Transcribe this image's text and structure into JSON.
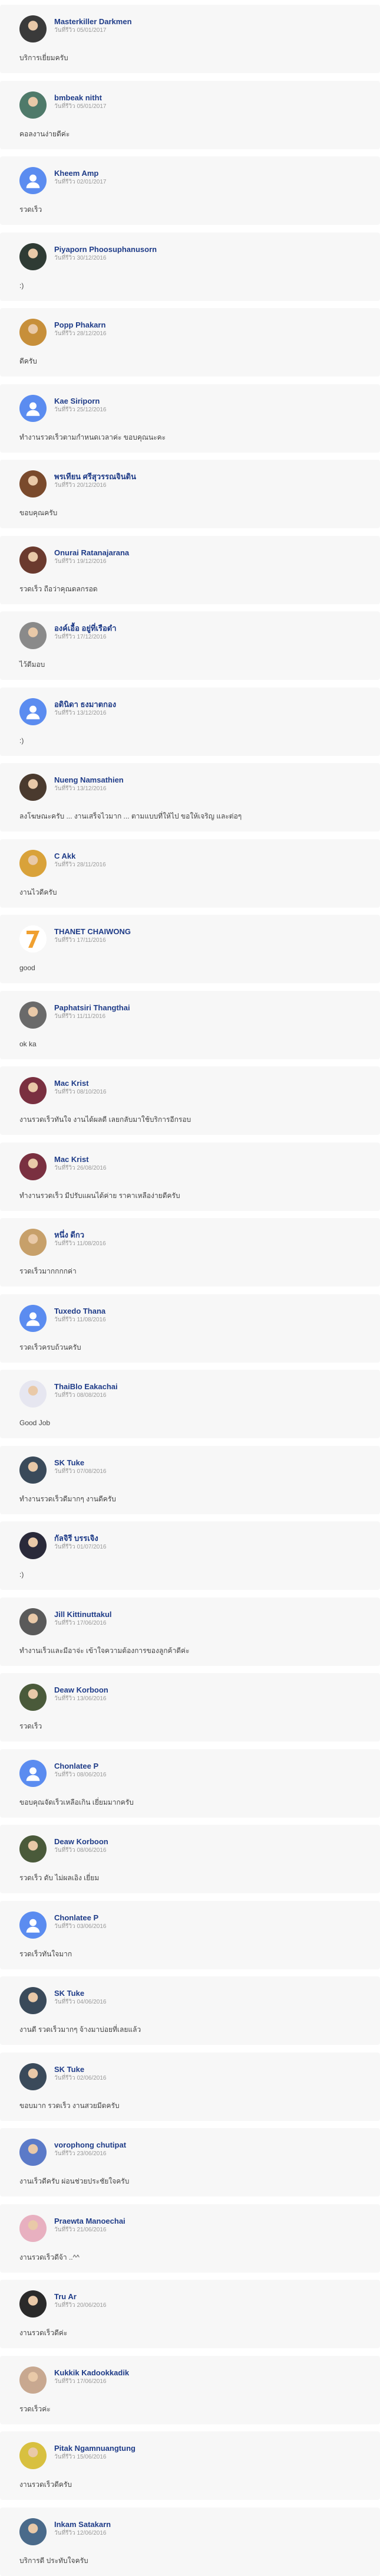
{
  "date_prefix": "วันที่รีวิว",
  "reviews": [
    {
      "name": "Masterkiller Darkmen",
      "date": "05/01/2017",
      "comment": "บริการเยี่ยมครับ",
      "avatar": "photo",
      "avatar_color": "#3a3a3a"
    },
    {
      "name": "bmbeak nitht",
      "date": "05/01/2017",
      "comment": "คอลงานง่ายดีค่ะ",
      "avatar": "photo",
      "avatar_color": "#4f7a6a"
    },
    {
      "name": "Kheem Amp",
      "date": "02/01/2017",
      "comment": "รวดเร็ว",
      "avatar": "default",
      "avatar_color": "#5b8cf0"
    },
    {
      "name": "Piyaporn Phoosuphanusorn",
      "date": "30/12/2016",
      "comment": ":)",
      "avatar": "photo",
      "avatar_color": "#2f3b34"
    },
    {
      "name": "Popp Phakarn",
      "date": "28/12/2016",
      "comment": "ดีครับ",
      "avatar": "photo",
      "avatar_color": "#c78f3a"
    },
    {
      "name": "Kae Siriporn",
      "date": "25/12/2016",
      "comment": "ทำงานรวดเร็วตามกำหนดเวลาค่ะ ขอบคุณนะคะ",
      "avatar": "default",
      "avatar_color": "#5b8cf0"
    },
    {
      "name": "พรเทียน ศรีสุวรรณจินดิน",
      "date": "20/12/2016",
      "comment": "ขอบคุณครับ",
      "avatar": "photo",
      "avatar_color": "#7a4a2c"
    },
    {
      "name": "Onurai Ratanajarana",
      "date": "19/12/2016",
      "comment": "รวดเร็ว ถือว่าคุณดลกรอด",
      "avatar": "photo",
      "avatar_color": "#6b3a2e"
    },
    {
      "name": "องค์เอื้อ อยู่ที่เรือดำ",
      "date": "17/12/2016",
      "comment": "ไว้ดีมอบ",
      "avatar": "photo",
      "avatar_color": "#8a8a8a"
    },
    {
      "name": "อดินิดา ธงมาตกอง",
      "date": "13/12/2016",
      "comment": ":)",
      "avatar": "default",
      "avatar_color": "#5b8cf0"
    },
    {
      "name": "Nueng Namsathien",
      "date": "13/12/2016",
      "comment": "ลงโฆษณะครับ ... งานเสร็จไวมาก ... ตามแบบที่ให้ไป ขอให้เจริญ และต่อๆ",
      "avatar": "photo",
      "avatar_color": "#4a3a2e"
    },
    {
      "name": "C Akk",
      "date": "28/11/2016",
      "comment": "งานไวดีครับ",
      "avatar": "photo",
      "avatar_color": "#d9a23a"
    },
    {
      "name": "THANET CHAIWONG",
      "date": "17/11/2016",
      "comment": "good",
      "avatar": "seven",
      "avatar_color": "#ffffff"
    },
    {
      "name": "Paphatsiri Thangthai",
      "date": "11/11/2016",
      "comment": "ok ka",
      "avatar": "photo",
      "avatar_color": "#6a6a6a"
    },
    {
      "name": "Mac Krist",
      "date": "08/10/2016",
      "comment": "งานรวดเร็วทันใจ งานได้ผลดี เลยกลับมาใช้บริการอีกรอบ",
      "avatar": "photo",
      "avatar_color": "#7a3040"
    },
    {
      "name": "Mac Krist",
      "date": "26/08/2016",
      "comment": "ทำงานรวดเร็ว มีปรับแผนได้ค่าย ราคาเหลือง่ายดีครับ",
      "avatar": "photo",
      "avatar_color": "#7a3040"
    },
    {
      "name": "หนึ่ง ดีกว",
      "date": "11/08/2016",
      "comment": "รวดเร็วมากกกกค่า",
      "avatar": "photo",
      "avatar_color": "#c7a06a"
    },
    {
      "name": "Tuxedo Thana",
      "date": "11/08/2016",
      "comment": "รวดเร็วครบถ้วนครับ",
      "avatar": "default",
      "avatar_color": "#5b8cf0"
    },
    {
      "name": "ThaiBlo Eakachai",
      "date": "08/08/2016",
      "comment": "Good Job",
      "avatar": "photo",
      "avatar_color": "#e6e6f0"
    },
    {
      "name": "SK Tuke",
      "date": "07/08/2016",
      "comment": "ทำงานรวดเร็วดีมากๆ งานดีครับ",
      "avatar": "photo",
      "avatar_color": "#3a4a5a"
    },
    {
      "name": "กัลจิรี บรรเจิง",
      "date": "01/07/2016",
      "comment": ":)",
      "avatar": "photo",
      "avatar_color": "#2a2a3a"
    },
    {
      "name": "Jill Kittinuttakul",
      "date": "17/06/2016",
      "comment": "ทำงานเร็วและมีอาจ่ะ เข้าใจความต้องการของลูกค้าดีค่ะ",
      "avatar": "photo",
      "avatar_color": "#5a5a5a"
    },
    {
      "name": "Deaw Korboon",
      "date": "13/06/2016",
      "comment": "รวดเร็ว",
      "avatar": "photo",
      "avatar_color": "#4a5a3a"
    },
    {
      "name": "Chonlatee P",
      "date": "08/06/2016",
      "comment": "ขอบคุณจัดเร็วเหลือเกิน เยี่ยมมากครับ",
      "avatar": "default",
      "avatar_color": "#5b8cf0"
    },
    {
      "name": "Deaw Korboon",
      "date": "08/06/2016",
      "comment": "รวดเร็ว ดับ ไม่ผลเอิง เยี่ยม",
      "avatar": "photo",
      "avatar_color": "#4a5a3a"
    },
    {
      "name": "Chonlatee P",
      "date": "03/06/2016",
      "comment": "รวดเร็วทันใจมาก",
      "avatar": "default",
      "avatar_color": "#5b8cf0"
    },
    {
      "name": "SK Tuke",
      "date": "04/06/2016",
      "comment": "งานดี รวดเร็วมากๆ จ้างมาบ่อยที่เลยแล้ว",
      "avatar": "photo",
      "avatar_color": "#3a4a5a"
    },
    {
      "name": "SK Tuke",
      "date": "02/06/2016",
      "comment": "ขอบมาก รวดเร็ว งานสวยมีดครับ",
      "avatar": "photo",
      "avatar_color": "#3a4a5a"
    },
    {
      "name": "vorophong chutipat",
      "date": "23/06/2016",
      "comment": "งานเร็วดีครับ ผ่อนช่วยประชัยใจครับ",
      "avatar": "photo",
      "avatar_color": "#5b7ac8"
    },
    {
      "name": "Praewta Manoechai",
      "date": "21/06/2016",
      "comment": "งานรวดเร็วดีจ้า ..^^",
      "avatar": "photo",
      "avatar_color": "#e8b0c0"
    },
    {
      "name": "Tru Ar",
      "date": "20/06/2016",
      "comment": "งานรวดเร็วดีค่ะ",
      "avatar": "photo",
      "avatar_color": "#2a2a2a"
    },
    {
      "name": "Kukkik Kadookkadik",
      "date": "17/06/2016",
      "comment": "รวดเร็วค่ะ",
      "avatar": "photo",
      "avatar_color": "#c8a890"
    },
    {
      "name": "Pitak Ngamnuangtung",
      "date": "15/06/2016",
      "comment": "งานรวดเร็วดีครับ",
      "avatar": "photo",
      "avatar_color": "#d8c040"
    },
    {
      "name": "Inkam Satakarn",
      "date": "12/06/2016",
      "comment": "บริการดี ประทับใจครับ",
      "avatar": "photo",
      "avatar_color": "#4a6a8a"
    }
  ]
}
